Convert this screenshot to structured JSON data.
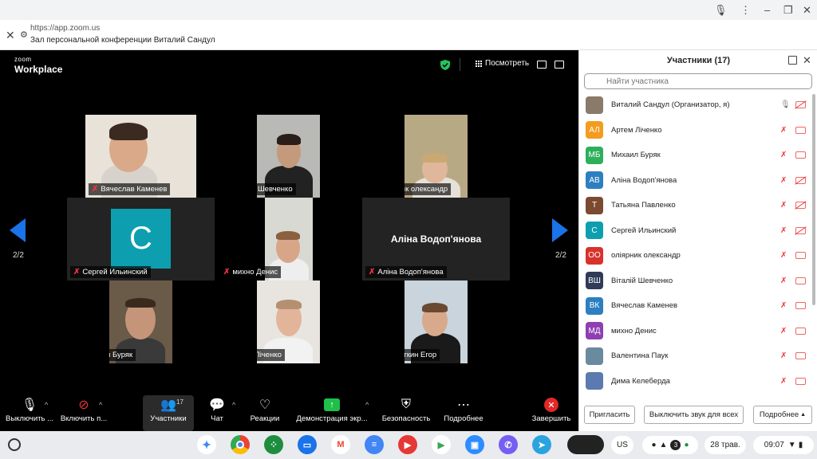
{
  "browser": {
    "url": "https://app.zoom.us",
    "title": "Зал персональной конференции Виталий Сандул"
  },
  "zoom": {
    "logo_small": "zoom",
    "logo_big": "Workplace",
    "view_label": "Посмотреть",
    "page_left": "2/2",
    "page_right": "2/2",
    "tiles": [
      {
        "name": "Вячеслав Каменев"
      },
      {
        "name": "Віталій Шевченко"
      },
      {
        "name": "оліярник олександр"
      },
      {
        "name": "Сергей Ильинский",
        "avatar_letter": "С"
      },
      {
        "name": "михно Денис"
      },
      {
        "name": "Аліна Водоп'янова",
        "big_name": "Аліна Водоп'янова"
      },
      {
        "name": "Михаил Буряк"
      },
      {
        "name": "Артем Лiченко"
      },
      {
        "name": "Куропаткин Егор"
      }
    ]
  },
  "toolbar": {
    "mute": "Выключить ...",
    "video": "Включить п...",
    "participants": "Участники",
    "participants_count": "17",
    "chat": "Чат",
    "reactions": "Реакции",
    "share": "Демонстрация экр...",
    "security": "Безопасность",
    "more": "Подробнее",
    "end": "Завершить"
  },
  "panel": {
    "title": "Участники (17)",
    "search_placeholder": "Найти участника",
    "participants": [
      {
        "name": "Виталий Сандул (Организатор, я)",
        "initials": "",
        "color": "#8a7a6a",
        "mic_on": true,
        "cam_off": true
      },
      {
        "name": "Артем Лiченко",
        "initials": "АЛ",
        "color": "#f39c1f",
        "mic_on": false,
        "cam_off": false
      },
      {
        "name": "Михаил Буряк",
        "initials": "МБ",
        "color": "#2eaf5c",
        "mic_on": false,
        "cam_off": false
      },
      {
        "name": "Аліна Водоп'янова",
        "initials": "АВ",
        "color": "#2d7fc1",
        "mic_on": false,
        "cam_off": true
      },
      {
        "name": "Татьяна Павленко",
        "initials": "Т",
        "color": "#7b4a2f",
        "mic_on": false,
        "cam_off": true
      },
      {
        "name": "Сергей Ильинский",
        "initials": "С",
        "color": "#0d9fb0",
        "mic_on": false,
        "cam_off": true
      },
      {
        "name": "оліярник олександр",
        "initials": "ОО",
        "color": "#d8322c",
        "mic_on": false,
        "cam_off": false
      },
      {
        "name": "Віталій Шевченко",
        "initials": "ВШ",
        "color": "#2f3b57",
        "mic_on": false,
        "cam_off": false
      },
      {
        "name": "Вячеслав Каменев",
        "initials": "ВК",
        "color": "#2d7fc1",
        "mic_on": false,
        "cam_off": false
      },
      {
        "name": "михно Денис",
        "initials": "МД",
        "color": "#8e3fb3",
        "mic_on": false,
        "cam_off": false
      },
      {
        "name": "Валентина Паук",
        "initials": "",
        "color": "#6a8aa0",
        "mic_on": false,
        "cam_off": false
      },
      {
        "name": "Дима Келеберда",
        "initials": "",
        "color": "#5a7ab0",
        "mic_on": false,
        "cam_off": false
      }
    ],
    "invite": "Пригласить",
    "mute_all": "Выключить звук для всех",
    "more": "Подробнее"
  },
  "shelf": {
    "lang": "US",
    "notif_count": "3",
    "date": "28 трав.",
    "time": "09:07"
  }
}
